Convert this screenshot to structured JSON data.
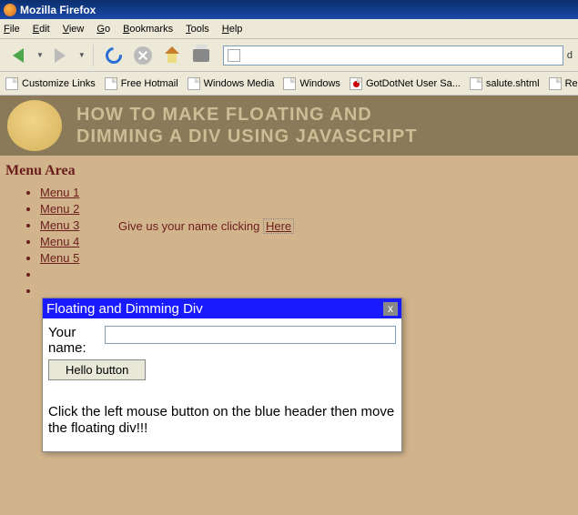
{
  "window": {
    "title": "Mozilla Firefox"
  },
  "menubar": [
    "File",
    "Edit",
    "View",
    "Go",
    "Bookmarks",
    "Tools",
    "Help"
  ],
  "urlbar": {
    "tail": "d"
  },
  "bookmarks": [
    {
      "label": "Customize Links"
    },
    {
      "label": "Free Hotmail"
    },
    {
      "label": "Windows Media"
    },
    {
      "label": "Windows"
    },
    {
      "label": "GotDotNet User Sa..."
    },
    {
      "label": "salute.shtml"
    },
    {
      "label": "Re"
    }
  ],
  "page": {
    "title_line1": "HOW TO MAKE FLOATING AND",
    "title_line2": "DIMMING A DIV USING JAVASCRIPT",
    "menu_heading": "Menu Area",
    "menus": [
      "Menu 1",
      "Menu 2",
      "Menu 3",
      "Menu 4",
      "Menu 5"
    ],
    "prompt_prefix": "Give us your name clicking ",
    "prompt_link": "Here"
  },
  "dialog": {
    "title": "Floating and Dimming Div",
    "close": "x",
    "name_label": "Your name:",
    "button": "Hello button",
    "instruction": "Click the left mouse button on the blue header then move the floating div!!!"
  }
}
